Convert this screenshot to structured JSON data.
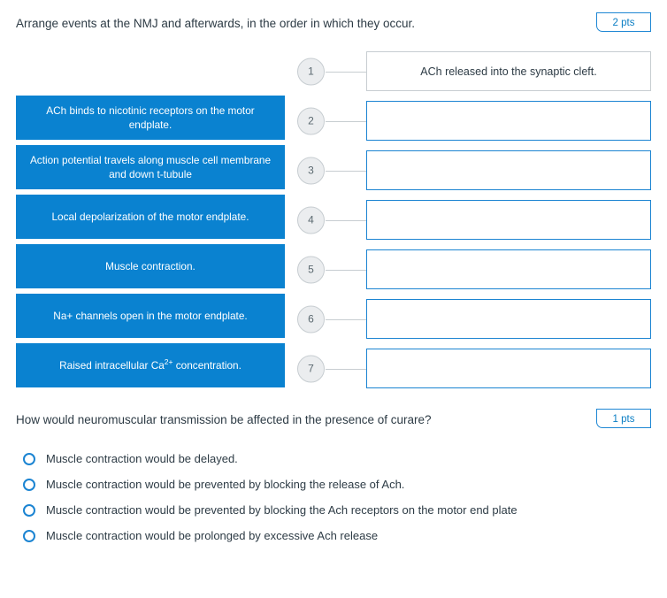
{
  "question_one": {
    "prompt": "Arrange events at the NMJ and afterwards, in the order in which they occur.",
    "points_badge": "2 pts",
    "draggable_options": [
      {
        "text_html": "ACh binds to nicotinic receptors on the motor endplate."
      },
      {
        "text_html": "Action potential travels along muscle cell membrane and down t-tubule"
      },
      {
        "text_html": "Local depolarization of the motor endplate."
      },
      {
        "text_html": "Muscle contraction."
      },
      {
        "text_html": "Na+ channels open in the motor endplate."
      },
      {
        "text_html": "Raised intracellular Ca<sup>2+</sup> concentration."
      }
    ],
    "slots": [
      {
        "number": "1",
        "value": "ACh released into the synaptic cleft.",
        "filled": true
      },
      {
        "number": "2",
        "value": "",
        "filled": false
      },
      {
        "number": "3",
        "value": "",
        "filled": false
      },
      {
        "number": "4",
        "value": "",
        "filled": false
      },
      {
        "number": "5",
        "value": "",
        "filled": false
      },
      {
        "number": "6",
        "value": "",
        "filled": false
      },
      {
        "number": "7",
        "value": "",
        "filled": false
      }
    ]
  },
  "question_two": {
    "prompt": "How would neuromuscular transmission be affected in the presence of curare?",
    "points_badge": "1 pts",
    "options": [
      {
        "label": "Muscle contraction would be delayed.",
        "selected": false
      },
      {
        "label": "Muscle contraction would be prevented by blocking the release of Ach.",
        "selected": false
      },
      {
        "label": "Muscle contraction would be prevented by blocking the Ach receptors on the motor end plate",
        "selected": false
      },
      {
        "label": "Muscle contraction would be prolonged by excessive Ach release",
        "selected": false
      }
    ]
  },
  "colors": {
    "option_blue": "#0a82d0",
    "slot_border_blue": "#1b84d2",
    "badge_blue": "#1e87d4",
    "circle_fill": "#ebedef",
    "text": "#2d3b45"
  }
}
